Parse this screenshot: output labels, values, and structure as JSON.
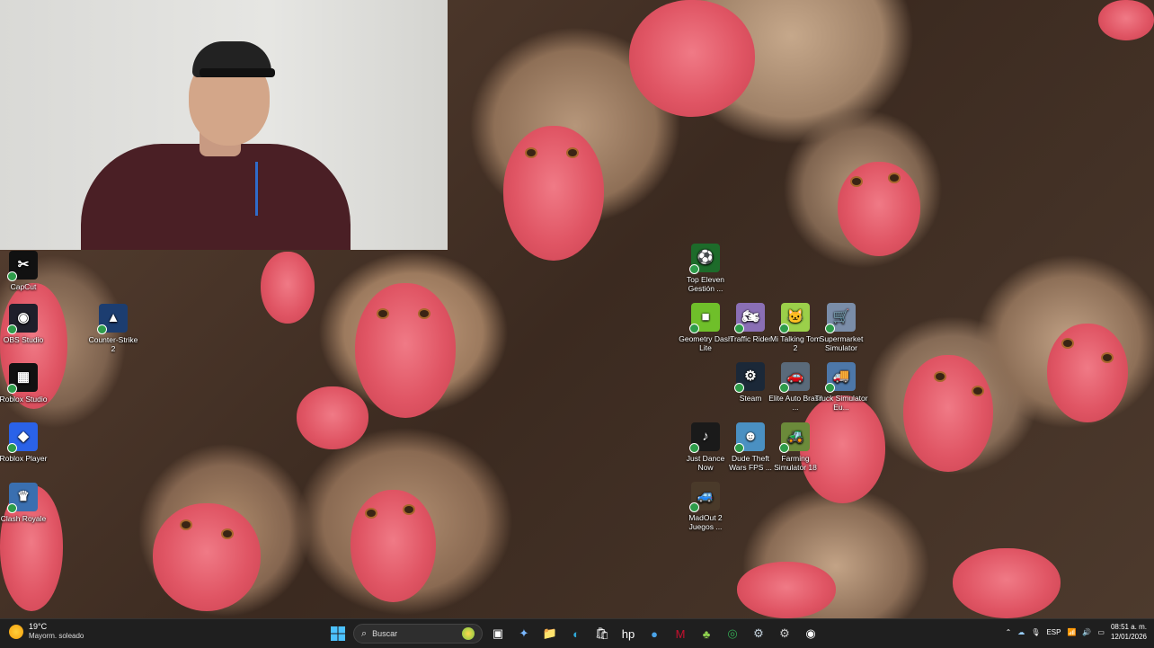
{
  "desktop_icons": [
    {
      "label": "CapCut",
      "icon": "capcut-icon",
      "color": "#111111",
      "glyph": "✂"
    },
    {
      "label": "OBS Studio",
      "icon": "obs-icon",
      "color": "#1f1f2b",
      "glyph": "◉"
    },
    {
      "label": "Counter-Strike 2",
      "icon": "counter-strike-icon",
      "color": "#1c3d70",
      "glyph": "▲"
    },
    {
      "label": "Roblox Studio",
      "icon": "roblox-studio-icon",
      "color": "#111111",
      "glyph": "▦"
    },
    {
      "label": "Roblox Player",
      "icon": "roblox-player-icon",
      "color": "#2a62e8",
      "glyph": "◆"
    },
    {
      "label": "Clash Royale",
      "icon": "clash-royale-icon",
      "color": "#3a6fb0",
      "glyph": "♛"
    },
    {
      "label": "Top Eleven Gestión ...",
      "icon": "top-eleven-icon",
      "color": "#1d6b2a",
      "glyph": "⚽"
    },
    {
      "label": "Geometry Dash Lite",
      "icon": "geometry-dash-icon",
      "color": "#6fbf2a",
      "glyph": "■"
    },
    {
      "label": "Traffic Rider",
      "icon": "traffic-rider-icon",
      "color": "#8a6fb5",
      "glyph": "🏍"
    },
    {
      "label": "Mi Talking Tom 2",
      "icon": "talking-tom-icon",
      "color": "#9bd04a",
      "glyph": "🐱"
    },
    {
      "label": "Supermarket Simulator",
      "icon": "supermarket-icon",
      "color": "#7a8da8",
      "glyph": "🛒"
    },
    {
      "label": "Steam",
      "icon": "steam-icon",
      "color": "#1b2838",
      "glyph": "⚙"
    },
    {
      "label": "Elite Auto Brasil ...",
      "icon": "elite-auto-icon",
      "color": "#5a6a7a",
      "glyph": "🚗"
    },
    {
      "label": "Truck Simulator Eu...",
      "icon": "truck-simulator-icon",
      "color": "#4d77a8",
      "glyph": "🚚"
    },
    {
      "label": "Just Dance Now",
      "icon": "just-dance-icon",
      "color": "#1a1a1a",
      "glyph": "♪"
    },
    {
      "label": "Dude Theft Wars FPS ...",
      "icon": "dude-theft-icon",
      "color": "#4a90c2",
      "glyph": "☻"
    },
    {
      "label": "Farming Simulator 18",
      "icon": "farming-simulator-icon",
      "color": "#6b8a3a",
      "glyph": "🚜"
    },
    {
      "label": "MadOut 2 Juegos ...",
      "icon": "madout-icon",
      "color": "#4a3a2a",
      "glyph": "🚙"
    }
  ],
  "taskbar": {
    "weather_temp": "19°C",
    "weather_desc": "Mayorm. soleado",
    "search_placeholder": "Buscar",
    "language": "ESP",
    "time": "08:51 a. m.",
    "date": "12/01/2026",
    "apps": [
      {
        "name": "task-view-icon",
        "glyph": "▣",
        "color": "#ffffff"
      },
      {
        "name": "copilot-icon",
        "glyph": "✦",
        "color": "#7ab8ff"
      },
      {
        "name": "file-explorer-icon",
        "glyph": "📁",
        "color": "#f2c13d"
      },
      {
        "name": "edge-icon",
        "glyph": "◐",
        "color": "#2fa8d8"
      },
      {
        "name": "microsoft-store-icon",
        "glyph": "🛍",
        "color": "#ffffff"
      },
      {
        "name": "hp-icon",
        "glyph": "hp",
        "color": "#ffffff"
      },
      {
        "name": "unknown-app-icon",
        "glyph": "●",
        "color": "#4aa3e8"
      },
      {
        "name": "mcafee-icon",
        "glyph": "M",
        "color": "#c8102e"
      },
      {
        "name": "game-app-icon",
        "glyph": "♣",
        "color": "#8fd14f"
      },
      {
        "name": "chrome-icon",
        "glyph": "◎",
        "color": "#34a853"
      },
      {
        "name": "steam-taskbar-icon",
        "glyph": "⚙",
        "color": "#c7d5e0"
      },
      {
        "name": "settings-icon",
        "glyph": "⚙",
        "color": "#cfcfcf"
      },
      {
        "name": "obs-taskbar-icon",
        "glyph": "◉",
        "color": "#ffffff"
      }
    ]
  }
}
